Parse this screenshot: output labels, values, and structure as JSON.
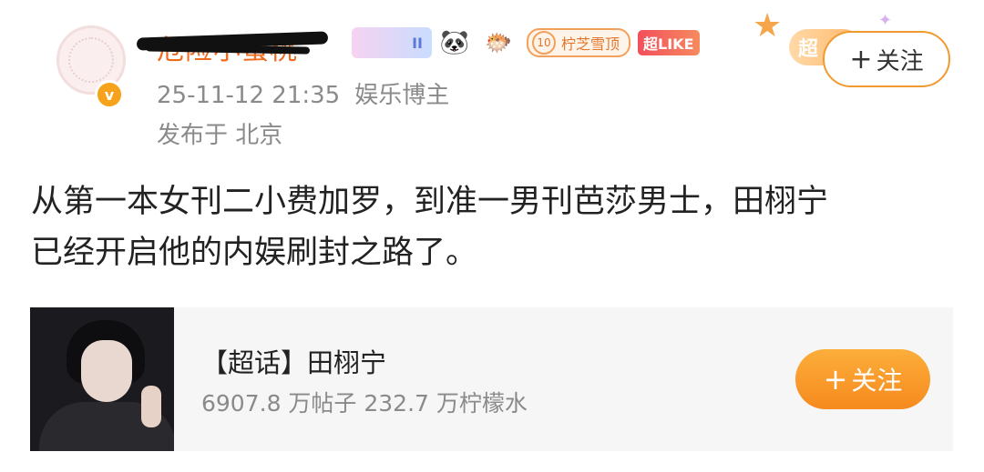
{
  "post": {
    "author_name": "危险小蜜桃-",
    "verified_badge": "v",
    "badges": {
      "constellation": "II",
      "panda_icon": "🐼",
      "fish_icon": "🐡",
      "level_number": "10",
      "level_label": "柠芝雪顶",
      "like_label": "超LIKE"
    },
    "decoration_text": "超",
    "follow_label": "关注",
    "timestamp": "25-11-12 21:35",
    "category": "娱乐博主",
    "location": "发布于 北京",
    "content_line1": "从第一本女刊二小费加罗，到准一男刊芭莎男士，田栩宁",
    "content_line2": "已经开启他的内娱刷封之路了。"
  },
  "card": {
    "title": "【超话】田栩宁",
    "stats": "6907.8 万帖子 232.7 万柠檬水",
    "follow_label": "关注"
  },
  "colors": {
    "accent_orange": "#f68a1f",
    "name_orange": "#f06a1e",
    "meta_gray": "#8a8a8a"
  }
}
